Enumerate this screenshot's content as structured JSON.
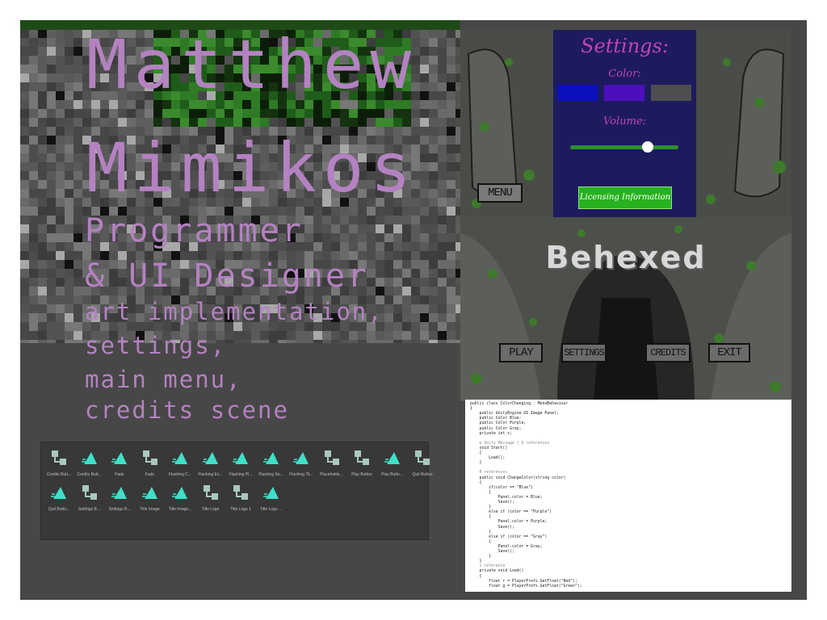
{
  "portfolio": {
    "name_line1": "Matthew",
    "name_line2": "Mimikos",
    "role_line1": "Programmer",
    "role_line2": "& UI Designer",
    "duties": [
      "art implementation,",
      "settings,",
      "main menu,",
      "credits scene"
    ]
  },
  "assets_panel": {
    "items": [
      {
        "label": "Credits Butt...",
        "icon": "prefab-icon"
      },
      {
        "label": "Credits Butt...",
        "icon": "animation-clip-icon"
      },
      {
        "label": "Fade",
        "icon": "animation-clip-icon"
      },
      {
        "label": "Fade",
        "icon": "prefab-icon"
      },
      {
        "label": "Flashing C...",
        "icon": "animation-clip-icon"
      },
      {
        "label": "Flashing Ex...",
        "icon": "animation-clip-icon"
      },
      {
        "label": "Flashing Pl...",
        "icon": "animation-clip-icon"
      },
      {
        "label": "Flashing Se...",
        "icon": "animation-clip-icon"
      },
      {
        "label": "Flashing Tit...",
        "icon": "animation-clip-icon"
      },
      {
        "label": "Placeholde...",
        "icon": "prefab-icon"
      },
      {
        "label": "Play Button",
        "icon": "prefab-icon"
      },
      {
        "label": "Play Butto...",
        "icon": "animation-clip-icon"
      },
      {
        "label": "Quit Button",
        "icon": "prefab-icon"
      },
      {
        "label": "Quit Butto...",
        "icon": "animation-clip-icon"
      },
      {
        "label": "Settings B...",
        "icon": "prefab-icon"
      },
      {
        "label": "Settings B...",
        "icon": "animation-clip-icon"
      },
      {
        "label": "Title Image",
        "icon": "animation-clip-icon"
      },
      {
        "label": "Title Image...",
        "icon": "animation-clip-icon"
      },
      {
        "label": "Title Logo",
        "icon": "prefab-icon"
      },
      {
        "label": "Title Logo 1",
        "icon": "prefab-icon"
      },
      {
        "label": "Title Logo ...",
        "icon": "animation-clip-icon"
      }
    ]
  },
  "settings_screen": {
    "title": "Settings:",
    "color_label": "Color:",
    "volume_label": "Volume:",
    "volume_level": 0.72,
    "swatches": [
      "#0b0fbd",
      "#4d0fbd",
      "#4e4e4e"
    ],
    "license_button": "Licensing Information",
    "menu_button": "MENU"
  },
  "main_menu": {
    "game_title": "Behexed",
    "buttons": {
      "play": "PLAY",
      "settings": "SETTINGS",
      "credits": "CREDITS",
      "exit": "EXIT"
    }
  },
  "code_lines": [
    "public class ColorChanging : MonoBehaviour",
    "{",
    "    public UnityEngine.UI.Image Panel;",
    "    public Color Blue;",
    "    public Color Purple;",
    "    public Color Gray;",
    "    private int x;",
    "",
    "    ⊕ Unity Message | 0 references",
    "    void Start()",
    "    {",
    "        Load();",
    "    }",
    "",
    "    0 references",
    "    public void ChangeColor(string color)",
    "    {",
    "        if(color == \"Blue\")",
    "        {",
    "            Panel.color = Blue;",
    "            Save();",
    "        }",
    "        else if (color == \"Purple\")",
    "        {",
    "            Panel.color = Purple;",
    "            Save();",
    "        }",
    "        else if (color == \"Gray\")",
    "        {",
    "            Panel.color = Gray;",
    "            Save();",
    "        }",
    "    }",
    "    1 reference",
    "    private void Load()",
    "    {",
    "        float r = PlayerPrefs.GetFloat(\"Red\");",
    "        float g = PlayerPrefs.GetFloat(\"Green\");"
  ],
  "colors": {
    "accent_text": "#b482c1",
    "background": "#474747",
    "prefab_icon": "#a8c8c0",
    "animation_icon": "#3fe0c8"
  }
}
